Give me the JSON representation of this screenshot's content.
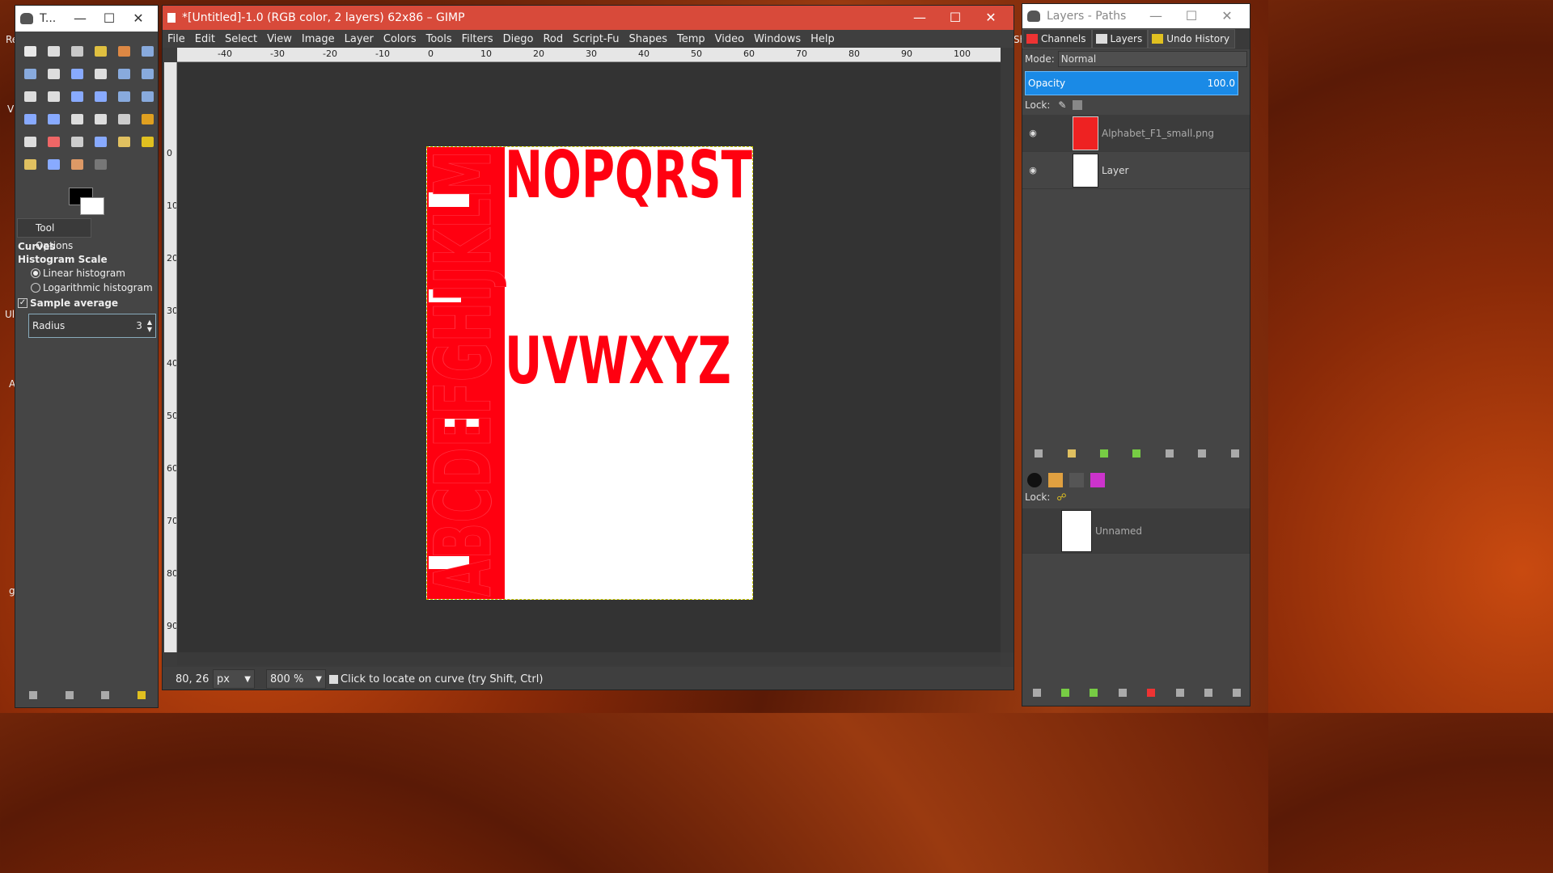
{
  "desktop": {
    "left_labels": [
      "Re",
      "Vi",
      "Ul",
      "A",
      "g"
    ],
    "right_label": "Sh"
  },
  "toolbox": {
    "title": "T...",
    "tool_options_tab": "Tool Options",
    "tool_name": "Curves",
    "histogram_scale": "Histogram Scale",
    "linear": "Linear histogram",
    "logarithmic": "Logarithmic histogram",
    "sample_average": "Sample average",
    "radius_label": "Radius",
    "radius_value": "3",
    "tool_colors": [
      "#e8e8e8",
      "#ddd",
      "#c8c8c8",
      "#e0c040",
      "#d84",
      "#8ad",
      "#8ad",
      "#ddd",
      "#8af",
      "#ddd",
      "#8ad",
      "#8ad",
      "#ddd",
      "#ddd",
      "#8af",
      "#8af",
      "#8ad",
      "#8ad",
      "#8af",
      "#8af",
      "#ddd",
      "#ddd",
      "#ccc",
      "#e0a020",
      "#ddd",
      "#e66",
      "#ccc",
      "#8af",
      "#e0c060",
      "#e0c020",
      "#e0c060",
      "#8af",
      "#d96",
      "#777"
    ]
  },
  "main": {
    "title": "*[Untitled]-1.0 (RGB color, 2 layers) 62x86 – GIMP",
    "menus": [
      "File",
      "Edit",
      "Select",
      "View",
      "Image",
      "Layer",
      "Colors",
      "Tools",
      "Filters",
      "Diego",
      "Rod",
      "Script-Fu",
      "Shapes",
      "Temp",
      "Video",
      "Windows",
      "Help"
    ],
    "hruler_ticks": [
      "-40",
      "-30",
      "-20",
      "-10",
      "0",
      "10",
      "20",
      "30",
      "40",
      "50",
      "60",
      "70",
      "80",
      "90",
      "100"
    ],
    "vruler_ticks": [
      "0",
      "10",
      "20",
      "30",
      "40",
      "50",
      "60",
      "70",
      "80",
      "90"
    ],
    "image_top_text": "NOPQRST",
    "image_mid_text": "UVWXYZ",
    "image_side_text": "ABCDEFGHIJKLM",
    "image_color": "#ff0010",
    "coords": "80, 26",
    "unit": "px",
    "zoom": "800 %",
    "status": "Click to locate on curve (try Shift, Ctrl)"
  },
  "layers": {
    "title": "Layers - Paths",
    "tabs": [
      "Channels",
      "Layers",
      "Undo History"
    ],
    "mode_label": "Mode:",
    "mode_value": "Normal",
    "opacity_label": "Opacity",
    "opacity_value": "100.0",
    "lock_label": "Lock:",
    "layer_items": [
      "Alphabet_F1_small.png",
      "Layer"
    ],
    "lower_lock_label": "Lock:",
    "path_item": "Unnamed"
  }
}
